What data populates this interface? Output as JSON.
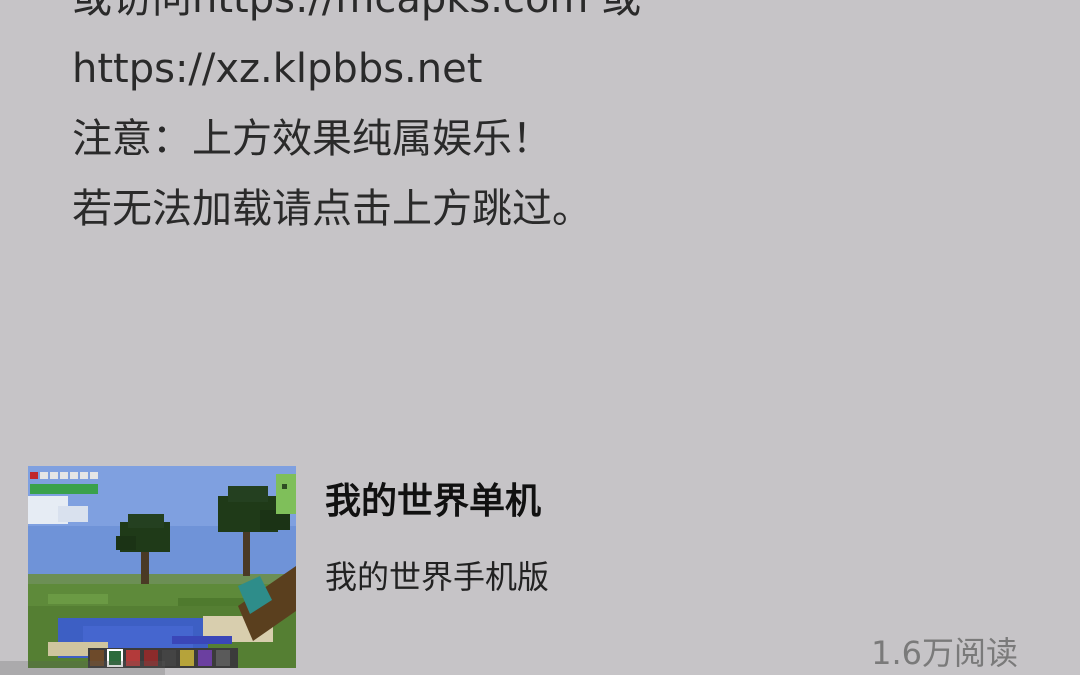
{
  "article": {
    "lines": [
      "或访问https://mcapks.com 或",
      "https://xz.klpbbs.net",
      "注意：上方效果纯属娱乐！",
      "若无法加载请点击上方跳过。"
    ]
  },
  "card": {
    "title": "我的世界单机",
    "subtitle": "我的世界手机版",
    "reads": "1.6万阅读",
    "thumbnail": "minecraft-screenshot-image"
  },
  "colors": {
    "background": "#c6c4c7",
    "text": "#2a2a2a",
    "muted": "#7a7a7a"
  }
}
